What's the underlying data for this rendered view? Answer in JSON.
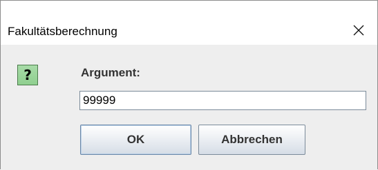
{
  "window": {
    "title": "Fakultätsberechnung"
  },
  "dialog": {
    "icon": "question-icon",
    "icon_glyph": "?",
    "icon_color": "#9ed49e",
    "field_label": "Argument:",
    "field_value": "99999",
    "ok_label": "OK",
    "cancel_label": "Abbrechen"
  }
}
